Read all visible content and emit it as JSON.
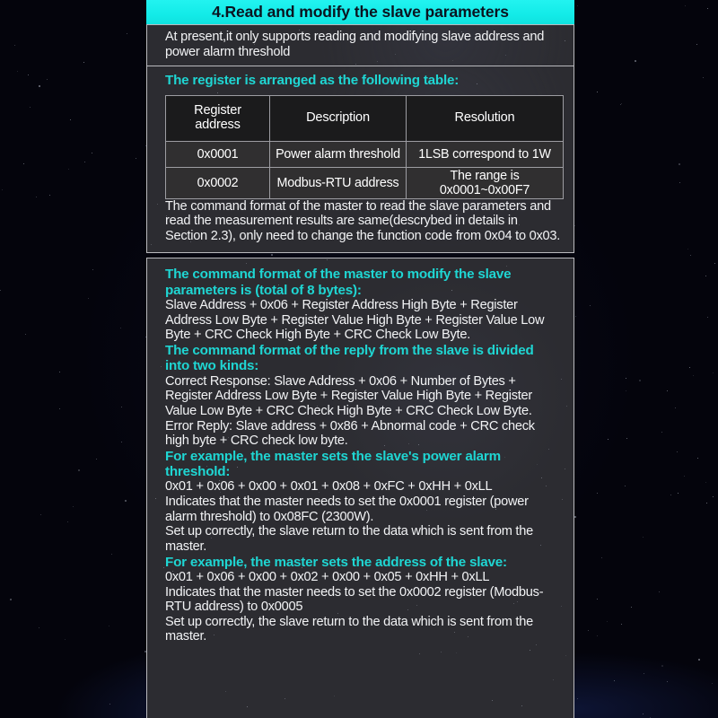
{
  "title": "4.Read and modify the slave parameters",
  "intro": "At present,it only supports reading and modifying slave address and power alarm threshold",
  "table_section": {
    "heading": "The register is arranged as the following table:",
    "columns": [
      "Register",
      "address",
      "Description",
      "Resolution"
    ],
    "rows": [
      {
        "address": "0x0001",
        "description": "Power alarm threshold",
        "resolution": "1LSB correspond to 1W"
      },
      {
        "address": "0x0002",
        "description": "Modbus-RTU address",
        "resolution": "The range is 0x0001~0x00F7"
      }
    ],
    "note": "The command format of the master to read the slave parameters and read the measurement results are same(descrybed in details in Section 2.3), only need to change the function code from 0x04 to 0x03."
  },
  "main": {
    "modify_heading": "The command format of the master to modify the slave parameters is (total of 8 bytes):",
    "modify_body": "Slave Address + 0x06 + Register Address High Byte + Register Address Low Byte + Register Value High Byte + Register Value Low Byte + CRC Check High Byte + CRC Check Low Byte.",
    "reply_heading": "The command format of the reply from the slave is divided into two kinds:",
    "reply_correct": "Correct Response: Slave Address + 0x06 + Number of Bytes + Register Address Low Byte + Register Value High Byte + Register Value Low Byte + CRC Check High Byte + CRC Check Low Byte.",
    "reply_error": "Error Reply: Slave address + 0x86 + Abnormal code + CRC check high byte + CRC check low byte.",
    "example1_heading": "For example, the master sets the slave's power alarm threshold:",
    "example1_command": "0x01 + 0x06 + 0x00 + 0x01 + 0x08 + 0xFC + 0xHH + 0xLL",
    "example1_indicates": "Indicates that the master needs to set the 0x0001 register (power alarm threshold) to 0x08FC (2300W).",
    "example1_result": "Set up correctly, the slave return to the data which is sent from the master.",
    "example2_heading": "For example, the master sets the address of the slave:",
    "example2_command": "0x01 + 0x06 + 0x00 + 0x02 + 0x00 + 0x05 + 0xHH + 0xLL",
    "example2_indicates": "Indicates that the master needs to set the 0x0002 register (Modbus-RTU address) to 0x0005",
    "example2_result": "Set up correctly, the slave return to the data which is sent from the master."
  },
  "colors": {
    "accent_cyan": "#1fd6d3",
    "title_bar": "#13ebe8",
    "panel_bg": "#2c2c31",
    "page_bg": "#04040c",
    "body_text": "#f2f3f5"
  }
}
